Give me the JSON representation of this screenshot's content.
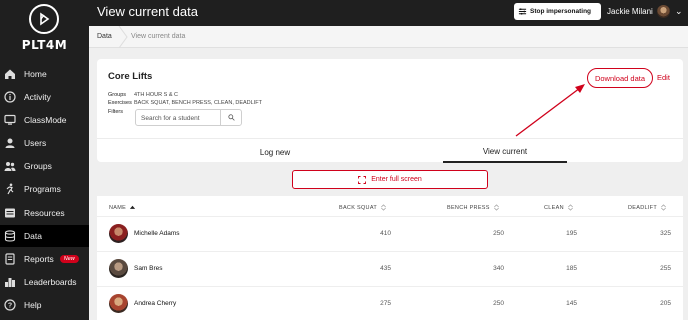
{
  "sidebar": {
    "logo_text": "PLT4M",
    "items": [
      {
        "label": "Home",
        "icon": "home-icon"
      },
      {
        "label": "Activity",
        "icon": "info-icon"
      },
      {
        "label": "ClassMode",
        "icon": "monitor-icon"
      },
      {
        "label": "Users",
        "icon": "user-icon"
      },
      {
        "label": "Groups",
        "icon": "groups-icon"
      },
      {
        "label": "Programs",
        "icon": "runner-icon"
      },
      {
        "label": "Resources",
        "icon": "resources-icon"
      },
      {
        "label": "Data",
        "icon": "database-icon"
      },
      {
        "label": "Reports",
        "icon": "report-icon",
        "badge": "New"
      },
      {
        "label": "Leaderboards",
        "icon": "leaderboard-icon"
      },
      {
        "label": "Help",
        "icon": "help-icon"
      }
    ],
    "active": "Data"
  },
  "header": {
    "title": "View current data",
    "stop_impersonating": "Stop impersonating",
    "user_name": "Jackie Milani"
  },
  "breadcrumb": {
    "items": [
      "Data",
      "View current data"
    ]
  },
  "card": {
    "title": "Core Lifts",
    "groups_label": "Groups",
    "groups_value": "4TH HOUR S & C",
    "exercises_label": "Exercises",
    "exercises_value": "BACK SQUAT, BENCH PRESS, CLEAN, DEADLIFT",
    "filters_label": "Filters",
    "search_placeholder": "Search for a student",
    "download_label": "Download data",
    "edit_label": "Edit",
    "tabs": [
      "Log new",
      "View current"
    ],
    "active_tab": "View current"
  },
  "fullscreen_label": "Enter full screen",
  "table": {
    "columns": [
      "NAME",
      "BACK SQUAT",
      "BENCH PRESS",
      "CLEAN",
      "DEADLIFT"
    ],
    "rows": [
      {
        "name": "Michelle Adams",
        "values": [
          "410",
          "250",
          "195",
          "325"
        ]
      },
      {
        "name": "Sam Bres",
        "values": [
          "435",
          "340",
          "185",
          "255"
        ]
      },
      {
        "name": "Andrea Cherry",
        "values": [
          "275",
          "250",
          "145",
          "205"
        ]
      }
    ]
  },
  "colors": {
    "accent": "#d0011b",
    "sidebar_bg": "#1f1f1f",
    "page_bg": "#efefef"
  }
}
